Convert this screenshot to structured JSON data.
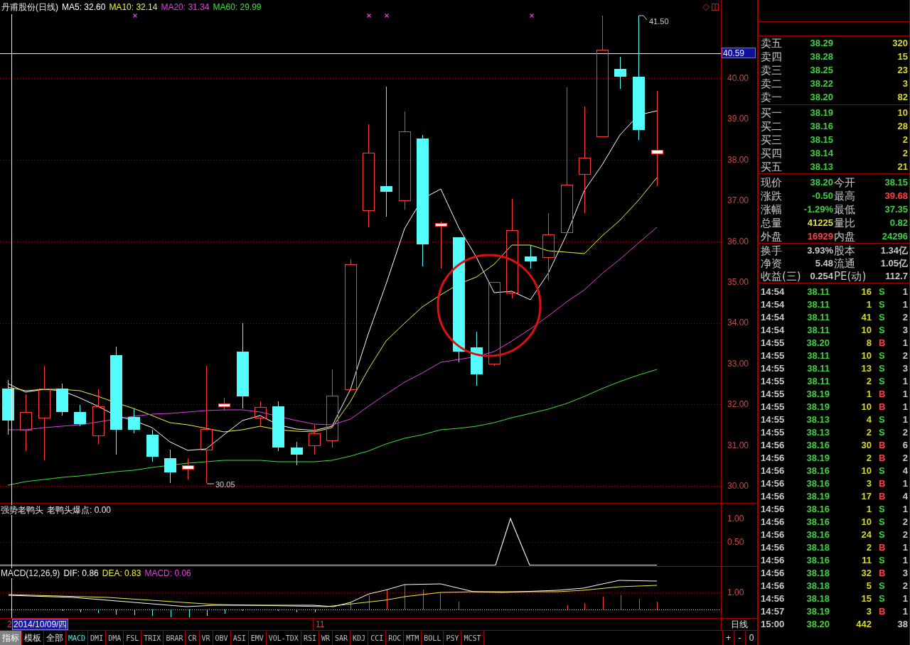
{
  "chart": {
    "title": "丹甫股份(日线)",
    "ma_legend": [
      {
        "label": "MA5: 32.60",
        "color": "#ffffff"
      },
      {
        "label": "MA10: 32.14",
        "color": "#f0f040"
      },
      {
        "label": "MA20: 31.34",
        "color": "#e040e0"
      },
      {
        "label": "MA60: 29.99",
        "color": "#40e040"
      }
    ],
    "price_axis": [
      "40.00",
      "39.00",
      "38.00",
      "37.00",
      "36.00",
      "35.00",
      "34.00",
      "33.00",
      "32.00",
      "31.00",
      "30.00"
    ],
    "cursor_price": "40.59",
    "high_label": "41.50",
    "low_label": "30.05"
  },
  "indicator_panel": {
    "title": "强势老鸭头",
    "value": "老鸭头爆点: 0.00",
    "axis": [
      "1.00",
      "0.50"
    ]
  },
  "macd_panel": {
    "title": "MACD(12,26,9)",
    "legend": [
      {
        "label": "DIF: 0.86",
        "color": "#ffffff"
      },
      {
        "label": "DEA: 0.83",
        "color": "#f0f040"
      },
      {
        "label": "MACD: 0.06",
        "color": "#e040e0"
      }
    ],
    "axis": [
      "1.00"
    ]
  },
  "date_axis": {
    "edge_label": "2",
    "cursor_date": "2014/10/09/四",
    "month_label": "11",
    "period": "日线"
  },
  "toolbar": {
    "modes": [
      {
        "label": "指标",
        "selected": true
      },
      {
        "label": "模板",
        "selected": false
      },
      {
        "label": "全部",
        "selected": false
      }
    ],
    "indicators": [
      {
        "label": "MACD",
        "selected": true
      },
      {
        "label": "DMI",
        "selected": false
      },
      {
        "label": "DMA",
        "selected": false
      },
      {
        "label": "FSL",
        "selected": false
      },
      {
        "label": "TRIX",
        "selected": false
      },
      {
        "label": "BRAR",
        "selected": false
      },
      {
        "label": "CR",
        "selected": false
      },
      {
        "label": "VR",
        "selected": false
      },
      {
        "label": "OBV",
        "selected": false
      },
      {
        "label": "ASI",
        "selected": false
      },
      {
        "label": "EMV",
        "selected": false
      },
      {
        "label": "VOL-TDX",
        "selected": false
      },
      {
        "label": "RSI",
        "selected": false
      },
      {
        "label": "WR",
        "selected": false
      },
      {
        "label": "SAR",
        "selected": false
      },
      {
        "label": "KDJ",
        "selected": false
      },
      {
        "label": "CCI",
        "selected": false
      },
      {
        "label": "ROC",
        "selected": false
      },
      {
        "label": "MTM",
        "selected": false
      },
      {
        "label": "BOLL",
        "selected": false
      },
      {
        "label": "PSY",
        "selected": false
      },
      {
        "label": "MCST",
        "selected": false
      }
    ],
    "scale_buttons": [
      "+",
      "-",
      "0"
    ]
  },
  "quote": {
    "asks": [
      {
        "label": "卖五",
        "price": "38.29",
        "volume": "320"
      },
      {
        "label": "卖四",
        "price": "38.28",
        "volume": "15"
      },
      {
        "label": "卖三",
        "price": "38.25",
        "volume": "23"
      },
      {
        "label": "卖二",
        "price": "38.22",
        "volume": "3"
      },
      {
        "label": "卖一",
        "price": "38.20",
        "volume": "82"
      }
    ],
    "bids": [
      {
        "label": "买一",
        "price": "38.19",
        "volume": "10"
      },
      {
        "label": "买二",
        "price": "38.16",
        "volume": "28"
      },
      {
        "label": "买三",
        "price": "38.15",
        "volume": "2"
      },
      {
        "label": "买四",
        "price": "38.14",
        "volume": "2"
      },
      {
        "label": "买五",
        "price": "38.13",
        "volume": "21"
      }
    ],
    "stats": [
      {
        "label": "现价",
        "value": "38.20",
        "color": "#40d040"
      },
      {
        "label": "今开",
        "value": "38.15",
        "color": "#40d040"
      },
      {
        "label": "涨跌",
        "value": "-0.50",
        "color": "#40d040"
      },
      {
        "label": "最高",
        "value": "39.68",
        "color": "#ff4040"
      },
      {
        "label": "涨幅",
        "value": "-1.29%",
        "color": "#40d040"
      },
      {
        "label": "最低",
        "value": "37.35",
        "color": "#40d040"
      },
      {
        "label": "总量",
        "value": "41225",
        "color": "#e0e040"
      },
      {
        "label": "量比",
        "value": "0.82",
        "color": "#40d040"
      },
      {
        "label": "外盘",
        "value": "16929",
        "color": "#ff4040"
      },
      {
        "label": "内盘",
        "value": "24296",
        "color": "#40d040"
      }
    ],
    "fundamentals": [
      {
        "label": "换手",
        "value": "3.93%"
      },
      {
        "label": "股本",
        "value": "1.34亿"
      },
      {
        "label": "净资",
        "value": "5.48"
      },
      {
        "label": "流通",
        "value": "1.05亿"
      },
      {
        "label": "收益(三)",
        "value": "0.254"
      },
      {
        "label": "PE(动)",
        "value": "112.7"
      }
    ]
  },
  "trades": [
    {
      "time": "14:54",
      "price": "38.11",
      "volume": "16",
      "side": "S",
      "kind": "sell",
      "count": "1"
    },
    {
      "time": "14:54",
      "price": "38.11",
      "volume": "1",
      "side": "S",
      "kind": "sell",
      "count": "1"
    },
    {
      "time": "14:54",
      "price": "38.11",
      "volume": "41",
      "side": "S",
      "kind": "sell",
      "count": "2"
    },
    {
      "time": "14:54",
      "price": "38.11",
      "volume": "10",
      "side": "S",
      "kind": "sell",
      "count": "3"
    },
    {
      "time": "14:55",
      "price": "38.20",
      "volume": "8",
      "side": "B",
      "kind": "buy",
      "count": "1"
    },
    {
      "time": "14:55",
      "price": "38.11",
      "volume": "10",
      "side": "S",
      "kind": "sell",
      "count": "2"
    },
    {
      "time": "14:55",
      "price": "38.11",
      "volume": "13",
      "side": "S",
      "kind": "sell",
      "count": "3"
    },
    {
      "time": "14:55",
      "price": "38.11",
      "volume": "2",
      "side": "S",
      "kind": "sell",
      "count": "1"
    },
    {
      "time": "14:55",
      "price": "38.19",
      "volume": "1",
      "side": "B",
      "kind": "buy",
      "count": "1"
    },
    {
      "time": "14:55",
      "price": "38.19",
      "volume": "10",
      "side": "B",
      "kind": "buy",
      "count": "1"
    },
    {
      "time": "14:55",
      "price": "38.13",
      "volume": "4",
      "side": "S",
      "kind": "sell",
      "count": "1"
    },
    {
      "time": "14:55",
      "price": "38.13",
      "volume": "2",
      "side": "S",
      "kind": "sell",
      "count": "2"
    },
    {
      "time": "14:56",
      "price": "38.16",
      "volume": "30",
      "side": "B",
      "kind": "buy",
      "count": "6"
    },
    {
      "time": "14:56",
      "price": "38.19",
      "volume": "2",
      "side": "B",
      "kind": "buy",
      "count": "2"
    },
    {
      "time": "14:56",
      "price": "38.16",
      "volume": "10",
      "side": "S",
      "kind": "sell",
      "count": "4"
    },
    {
      "time": "14:56",
      "price": "38.16",
      "volume": "3",
      "side": "B",
      "kind": "buy",
      "count": "1"
    },
    {
      "time": "14:56",
      "price": "38.19",
      "volume": "17",
      "side": "B",
      "kind": "buy",
      "count": "4"
    },
    {
      "time": "14:56",
      "price": "38.16",
      "volume": "1",
      "side": "S",
      "kind": "sell",
      "count": "1"
    },
    {
      "time": "14:56",
      "price": "38.16",
      "volume": "10",
      "side": "S",
      "kind": "sell",
      "count": "2"
    },
    {
      "time": "14:56",
      "price": "38.16",
      "volume": "24",
      "side": "S",
      "kind": "sell",
      "count": "2"
    },
    {
      "time": "14:56",
      "price": "38.18",
      "volume": "2",
      "side": "B",
      "kind": "buy",
      "count": "1"
    },
    {
      "time": "14:56",
      "price": "38.16",
      "volume": "11",
      "side": "S",
      "kind": "sell",
      "count": "1"
    },
    {
      "time": "14:56",
      "price": "38.18",
      "volume": "32",
      "side": "B",
      "kind": "buy",
      "count": "3"
    },
    {
      "time": "14:56",
      "price": "38.18",
      "volume": "5",
      "side": "S",
      "kind": "sell",
      "count": "2"
    },
    {
      "time": "14:56",
      "price": "38.18",
      "volume": "15",
      "side": "S",
      "kind": "sell",
      "count": "1"
    },
    {
      "time": "14:57",
      "price": "38.19",
      "volume": "3",
      "side": "B",
      "kind": "buy",
      "count": "1"
    },
    {
      "time": "15:00",
      "price": "38.20",
      "volume": "442",
      "count": "38"
    }
  ]
}
